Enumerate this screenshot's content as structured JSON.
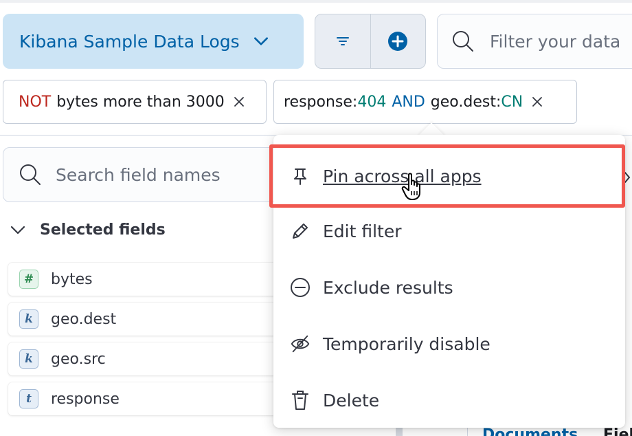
{
  "header": {
    "data_view_label": "Kibana Sample Data Logs",
    "query_placeholder": "Filter your data"
  },
  "filters": [
    {
      "negation": "NOT",
      "text": "bytes more than 3000"
    },
    {
      "field1": "response: ",
      "value1": "404",
      "operator": "AND",
      "field2": "geo.dest: ",
      "value2": "CN"
    }
  ],
  "sidebar": {
    "search_placeholder": "Search field names",
    "section_title": "Selected fields",
    "fields": [
      {
        "type": "#",
        "name": "bytes"
      },
      {
        "type": "k",
        "name": "geo.dest"
      },
      {
        "type": "k",
        "name": "geo.src"
      },
      {
        "type": "t",
        "name": "response"
      }
    ]
  },
  "context_menu": {
    "items": [
      {
        "label": "Pin across all apps",
        "icon": "pin-icon"
      },
      {
        "label": "Edit filter",
        "icon": "pencil-icon"
      },
      {
        "label": "Exclude results",
        "icon": "minus-circle-icon"
      },
      {
        "label": "Temporarily disable",
        "icon": "eye-closed-icon"
      },
      {
        "label": "Delete",
        "icon": "trash-icon"
      }
    ]
  },
  "background": {
    "tab_documents": "Documents",
    "tab_fields_partial": "Fiel"
  },
  "colors": {
    "accent": "#0061a6",
    "negation": "#bd271e",
    "value": "#017d73",
    "highlight": "#f0574f"
  }
}
